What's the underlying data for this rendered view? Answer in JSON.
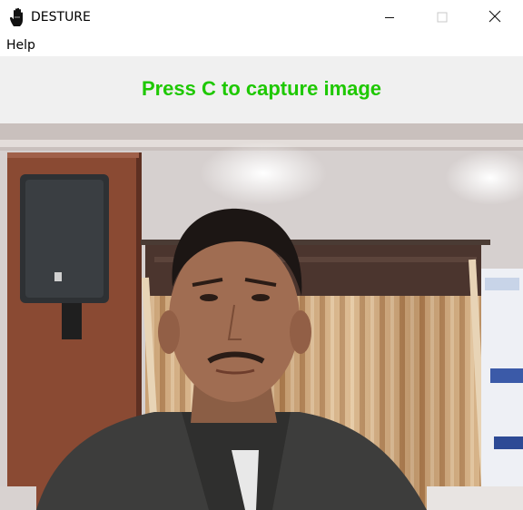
{
  "window": {
    "title": "DESTURE",
    "app_icon": "hand-icon",
    "controls": [
      "minimize-icon",
      "maximize-icon",
      "close-icon"
    ]
  },
  "menu": {
    "items": [
      {
        "label": "Help"
      }
    ]
  },
  "banner": {
    "text": "Press C to capture image",
    "color": "#1ec800"
  },
  "camera": {
    "content": "live webcam feed"
  },
  "colors": {
    "banner_bg": "#f0f0f0",
    "titlebar_bg": "#ffffff"
  }
}
